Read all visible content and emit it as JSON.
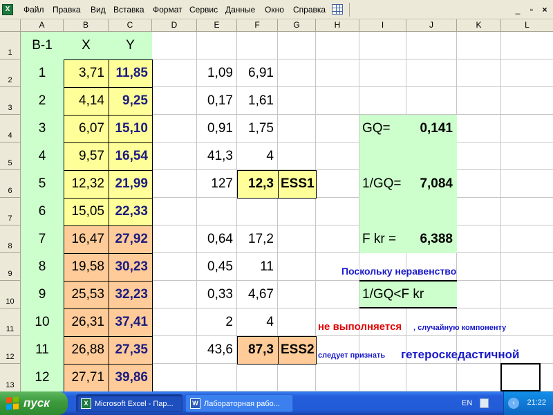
{
  "menubar": {
    "items": [
      "Файл",
      "Правка",
      "Вид",
      "Вставка",
      "Формат",
      "Сервис",
      "Данные",
      "Окно",
      "Справка"
    ],
    "icons": [
      "excel-app-icon",
      "grid-icon",
      "minimize-icon",
      "restore-icon",
      "close-icon"
    ],
    "window_controls": [
      "_",
      "▫",
      "×"
    ]
  },
  "columns": [
    "A",
    "B",
    "C",
    "D",
    "E",
    "F",
    "G",
    "H",
    "I",
    "J",
    "K",
    "L"
  ],
  "rows": [
    "1",
    "2",
    "3",
    "4",
    "5",
    "6",
    "7",
    "8",
    "9",
    "10",
    "11",
    "12",
    "13"
  ],
  "sheet": {
    "header": {
      "a": "В-1",
      "b": "X",
      "c": "Y"
    },
    "a": [
      "1",
      "2",
      "3",
      "4",
      "5",
      "6",
      "7",
      "8",
      "9",
      "10",
      "11",
      "12"
    ],
    "b": [
      "3,71",
      "4,14",
      "6,07",
      "9,57",
      "12,32",
      "15,05",
      "16,47",
      "19,58",
      "25,53",
      "26,31",
      "26,88",
      "27,71"
    ],
    "c": [
      "11,85",
      "9,25",
      "15,10",
      "16,54",
      "21,99",
      "22,33",
      "27,92",
      "30,23",
      "32,23",
      "37,41",
      "27,35",
      "39,86"
    ],
    "e_top": [
      "1,09",
      "0,17",
      "0,91",
      "41,3",
      "127"
    ],
    "f_top": [
      "6,91",
      "1,61",
      "1,75",
      "4",
      "12,3"
    ],
    "e_bottom": [
      "0,64",
      "0,45",
      "0,33",
      "2",
      "43,6"
    ],
    "f_bottom": [
      "17,2",
      "11",
      "4,67",
      "4",
      "87,3"
    ],
    "ess1": "ESS1",
    "ess2": "ESS2",
    "gq_label": "GQ=",
    "gq_value": "0,141",
    "inv_gq_label": "1/GQ=",
    "inv_gq_value": "7,084",
    "fkr_label": "F kr =",
    "fkr_value": "6,388",
    "ineq_text": "1/GQ<F kr",
    "note_line1": "Поскольку неравенство",
    "note_part1": "не выполняется",
    "note_part2": ", случайную компоненту",
    "note_part3": "следует признать",
    "note_part4": "гетероскедастичной"
  },
  "colors": {
    "green_fill": "#ccffcc",
    "yellow_fill": "#ffff99",
    "peach_fill": "#ffcc99",
    "navy_text": "#1c1c80",
    "red_text": "#e00000",
    "blue_text": "#1a1acc"
  },
  "taskbar": {
    "start_label": "пуск",
    "task1": "Microsoft Excel - Пар...",
    "task2": "Лабораторная рабо...",
    "lang": "EN",
    "clock": "21:22",
    "icons": [
      "windows-logo-icon",
      "excel-task-icon",
      "word-task-icon",
      "keyboard-layout-icon",
      "tray-expand-icon"
    ]
  }
}
